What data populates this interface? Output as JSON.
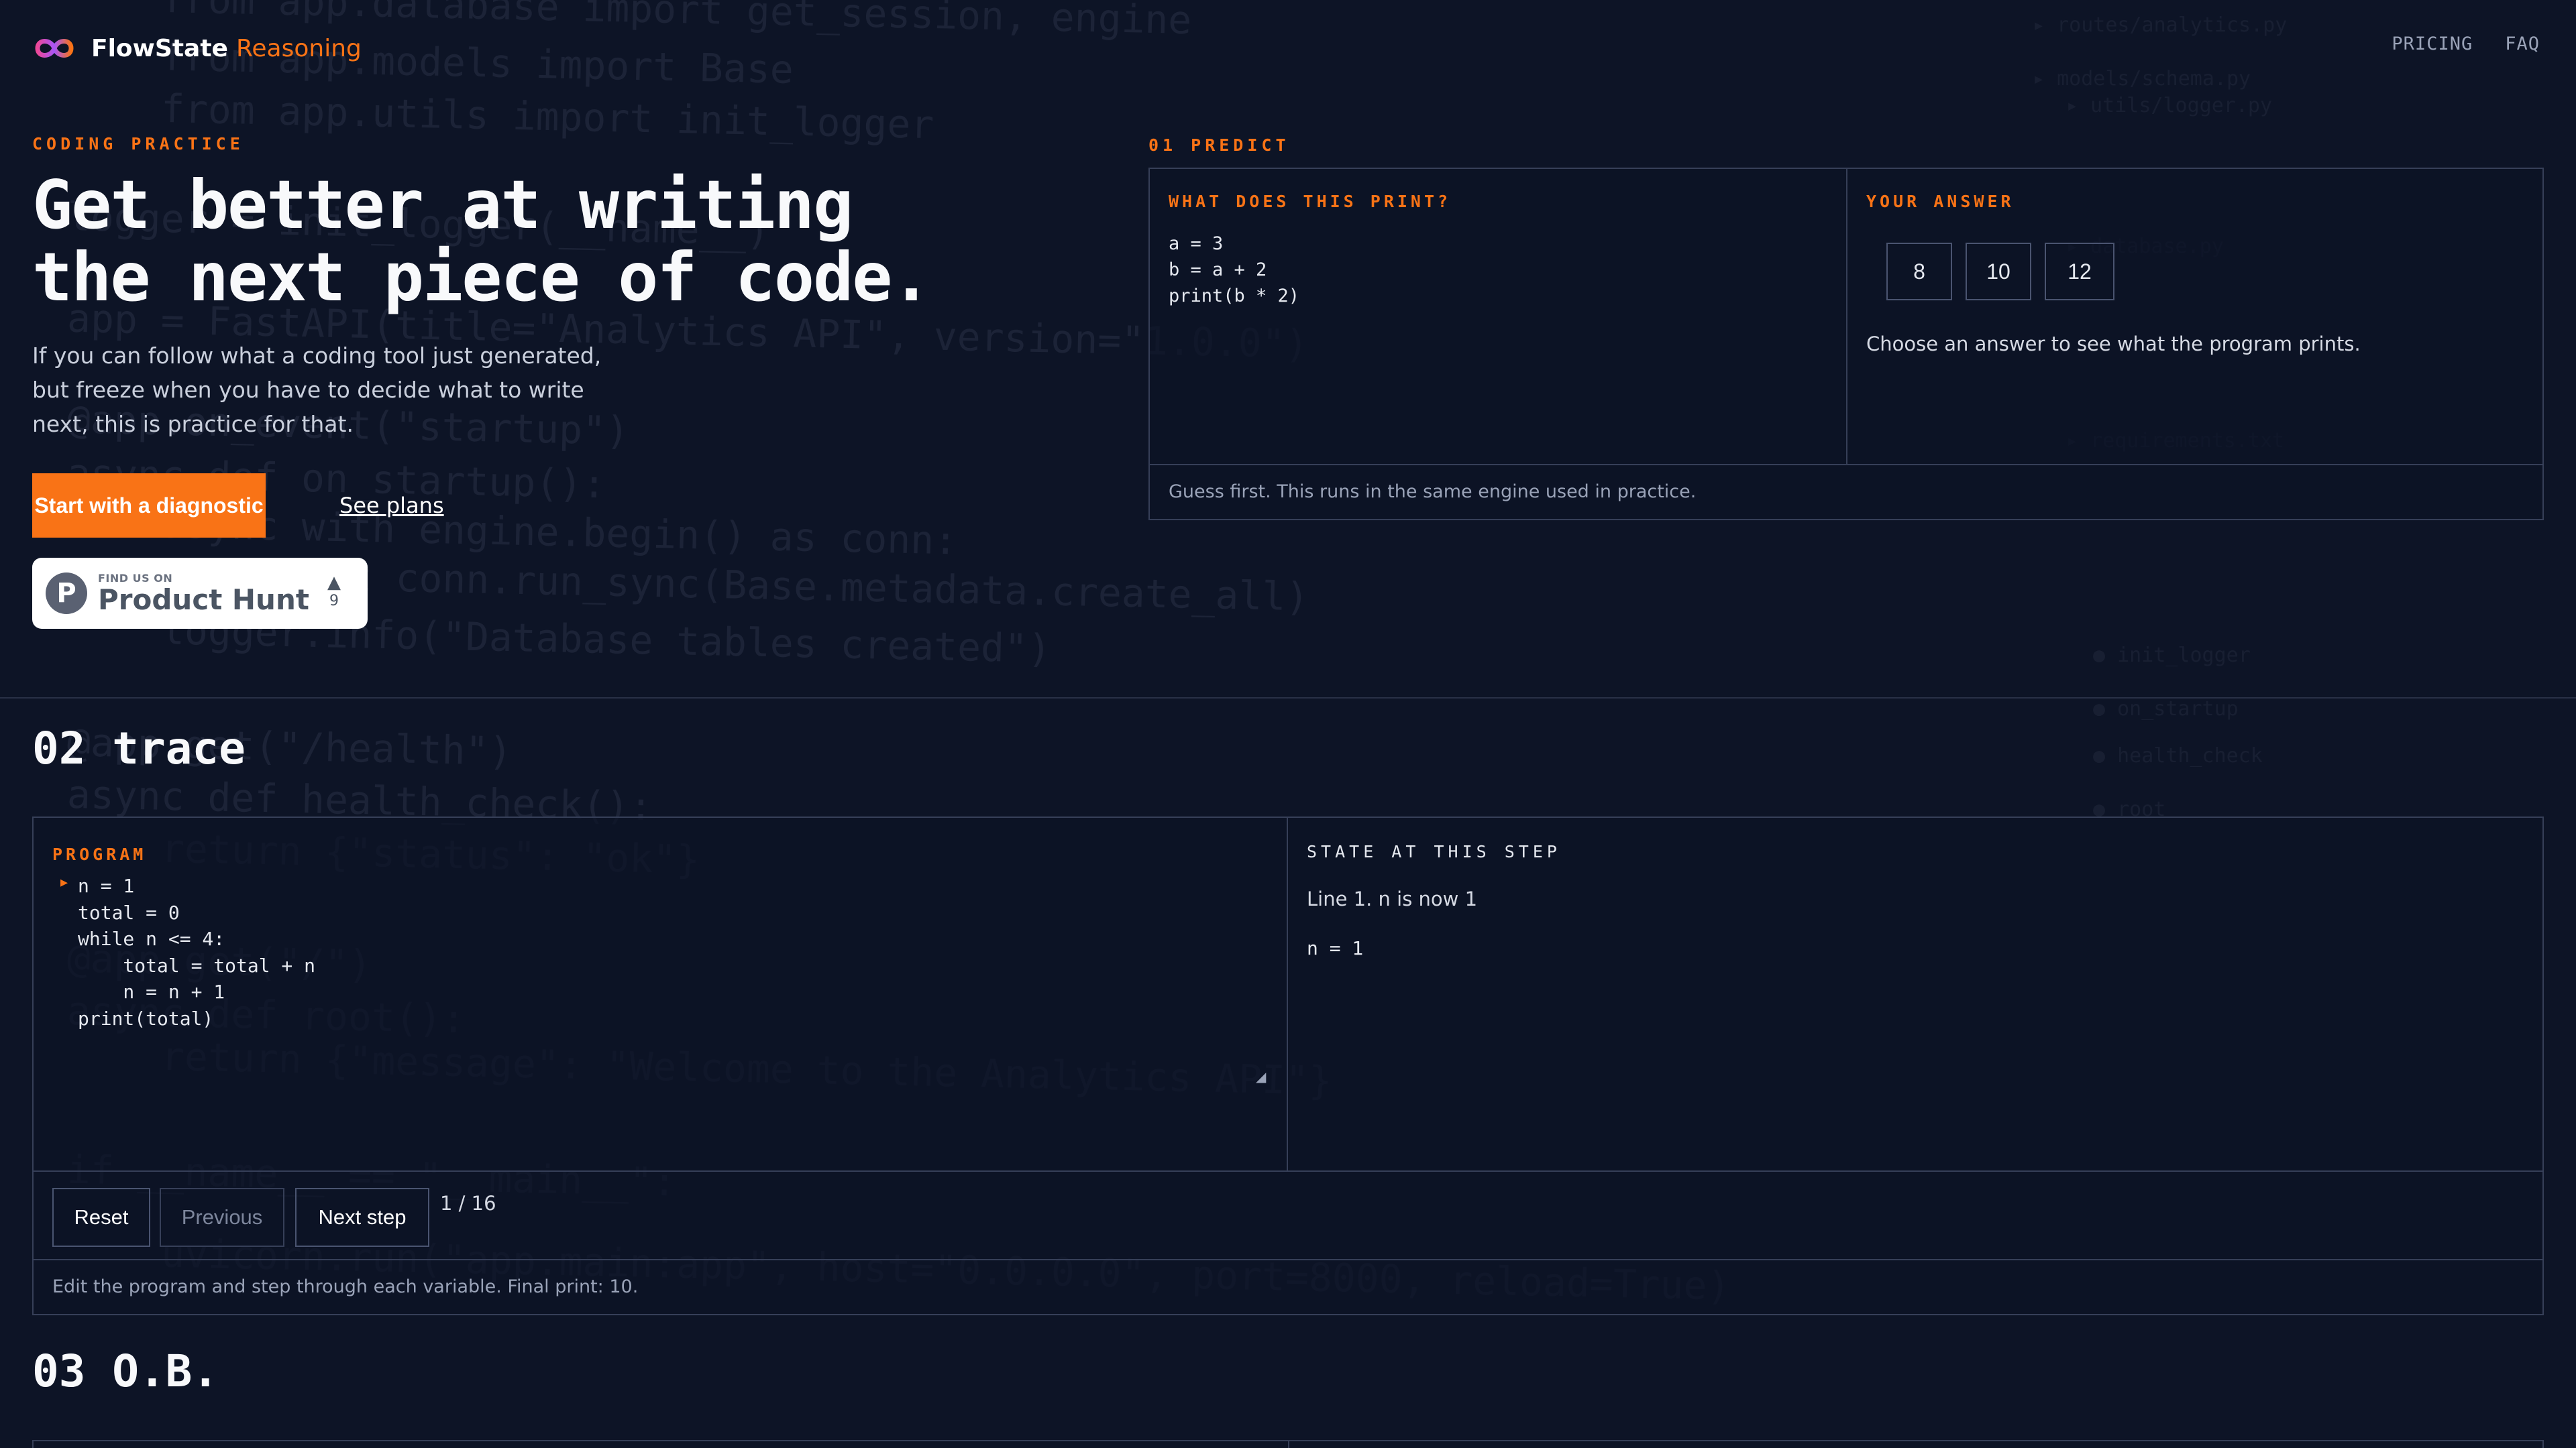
{
  "header": {
    "brand": "FlowState",
    "brand_accent": "Reasoning",
    "nav": [
      "PRICING",
      "FAQ"
    ]
  },
  "hero": {
    "eyebrow": "CODING PRACTICE",
    "title_line1": "Get better at writing",
    "title_line2": "the next piece of code.",
    "description": "If you can follow what a coding tool just generated, but freeze when you have to decide what to write next, this is practice for that.",
    "cta_label": "Start with a diagnostic",
    "secondary_link": "See plans",
    "product_hunt": {
      "small": "FIND US ON",
      "big": "Product Hunt",
      "logo_letter": "P",
      "vote_icon": "triangle-up-icon",
      "votes": "9"
    }
  },
  "predict": {
    "label": "01 PREDICT",
    "question_label": "WHAT DOES THIS PRINT?",
    "code": "a = 3\nb = a + 2\nprint(b * 2)",
    "answer_label": "YOUR ANSWER",
    "options": [
      "8",
      "10",
      "12"
    ],
    "hint": "Choose an answer to see what the program prints.",
    "footer": "Guess first. This runs in the same engine used in practice."
  },
  "trace": {
    "title": "02 trace",
    "program_label": "PROGRAM",
    "code": "n = 1\ntotal = 0\nwhile n <= 4:\n    total = total + n\n    n = n + 1\nprint(total)",
    "state_label": "STATE AT THIS STEP",
    "state_desc": "Line 1. n is now 1",
    "state_vars": "n = 1",
    "buttons": {
      "reset": "Reset",
      "previous": "Previous",
      "next": "Next step"
    },
    "step_count": "1 / 16",
    "footer": "Edit the program and step through each variable. Final print: 10."
  },
  "ob": {
    "title": "03 O.B."
  },
  "colors": {
    "background": "#0d1426",
    "accent": "#f97316",
    "border": "#363f58",
    "muted_text": "#9aa3b8"
  }
}
